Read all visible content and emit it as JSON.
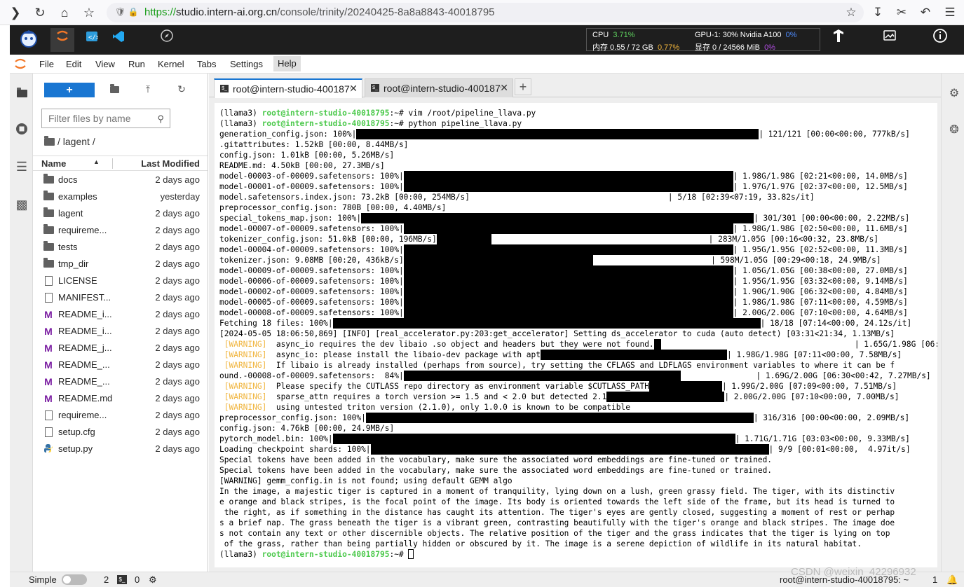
{
  "browser": {
    "url_scheme": "https://",
    "url_host": "studio.intern-ai.org.cn",
    "url_path": "/console/trinity/20240425-8a8a8843-40018795"
  },
  "monitor": {
    "cpu_label": "CPU",
    "cpu_value": "3.71%",
    "mem_label": "内存 0.55 / 72 GB",
    "mem_value": "0.77%",
    "gpu_label": "GPU-1: 30% Nvidia A100",
    "gpu_value": "0%",
    "vram_label": "显存 0 / 24566 MiB",
    "vram_value": "0%"
  },
  "menu": [
    "File",
    "Edit",
    "View",
    "Run",
    "Kernel",
    "Tabs",
    "Settings",
    "Help"
  ],
  "filebrowser": {
    "filter_placeholder": "Filter files by name",
    "breadcrumb": "/ lagent /",
    "col_name": "Name",
    "col_modified": "Last Modified",
    "files": [
      {
        "name": "docs",
        "modified": "2 days ago",
        "type": "folder"
      },
      {
        "name": "examples",
        "modified": "yesterday",
        "type": "folder"
      },
      {
        "name": "lagent",
        "modified": "2 days ago",
        "type": "folder"
      },
      {
        "name": "requireme...",
        "modified": "2 days ago",
        "type": "folder"
      },
      {
        "name": "tests",
        "modified": "2 days ago",
        "type": "folder"
      },
      {
        "name": "tmp_dir",
        "modified": "2 days ago",
        "type": "folder"
      },
      {
        "name": "LICENSE",
        "modified": "2 days ago",
        "type": "file"
      },
      {
        "name": "MANIFEST...",
        "modified": "2 days ago",
        "type": "file"
      },
      {
        "name": "README_i...",
        "modified": "2 days ago",
        "type": "markdown"
      },
      {
        "name": "README_i...",
        "modified": "2 days ago",
        "type": "markdown"
      },
      {
        "name": "README_j...",
        "modified": "2 days ago",
        "type": "markdown"
      },
      {
        "name": "README_...",
        "modified": "2 days ago",
        "type": "markdown"
      },
      {
        "name": "README_...",
        "modified": "2 days ago",
        "type": "markdown"
      },
      {
        "name": "README.md",
        "modified": "2 days ago",
        "type": "markdown"
      },
      {
        "name": "requireme...",
        "modified": "2 days ago",
        "type": "file"
      },
      {
        "name": "setup.cfg",
        "modified": "2 days ago",
        "type": "file"
      },
      {
        "name": "setup.py",
        "modified": "2 days ago",
        "type": "python"
      }
    ]
  },
  "tabs": [
    {
      "label": "root@intern-studio-40018795: ~"
    },
    {
      "label": "root@intern-studio-40018795: ~"
    }
  ],
  "terminal": {
    "prompt_env": "(llama3) ",
    "prompt_user": "root@intern-studio-40018795",
    "prompt_tail": ":~# ",
    "cmd1": "vim /root/pipeline_llava.py",
    "cmd2": "python pipeline_llava.py",
    "lines": [
      {
        "pre": "generation_config.json: 100%|",
        "bar": 574,
        "post": "| 121/121 [00:00<00:00, 777kB/s]"
      },
      {
        "pre": ".gitattributes: 1.52kB [00:00, 8.44MB/s]",
        "bar": 0,
        "post": ""
      },
      {
        "pre": "config.json: 1.01kB [00:00, 5.26MB/s]",
        "bar": 0,
        "post": ""
      },
      {
        "pre": "README.md: 4.50kB [00:00, 27.3MB/s]",
        "bar": 0,
        "post": ""
      },
      {
        "pre": "model-00003-of-00009.safetensors: 100%|",
        "bar": 470,
        "post": "| 1.98G/1.98G [02:21<00:00, 14.0MB/s]"
      },
      {
        "pre": "model-00001-of-00009.safetensors: 100%|",
        "bar": 470,
        "post": "| 1.97G/1.97G [02:37<00:00, 12.5MB/s]"
      },
      {
        "pre": "model.safetensors.index.json: 73.2kB [00:00, 254MB/s]",
        "bar": 0,
        "post": "                                          | 5/18 [02:39<07:19, 33.82s/it]"
      },
      {
        "pre": "preprocessor_config.json: 780B [00:00, 4.40MB/s]",
        "bar": 0,
        "post": ""
      },
      {
        "pre": "special_tokens_map.json: 100%|",
        "bar": 560,
        "post": "| 301/301 [00:00<00:00, 2.22MB/s]"
      },
      {
        "pre": "model-00007-of-00009.safetensors: 100%|",
        "bar": 470,
        "post": "| 1.98G/1.98G [02:50<00:00, 11.6MB/s]"
      },
      {
        "pre": "tokenizer_config.json: 51.0kB [00:00, 196MB/s]",
        "bar": 78,
        "post": "                                              | 283M/1.05G [00:16<00:32, 23.8MB/s]"
      },
      {
        "pre": "model-00004-of-00009.safetensors: 100%|",
        "bar": 470,
        "post": "| 1.95G/1.95G [02:52<00:00, 11.3MB/s]"
      },
      {
        "pre": "tokenizer.json: 9.08MB [00:20, 436kB/s]",
        "bar": 270,
        "post": "                         | 598M/1.05G [00:29<00:18, 24.9MB/s]"
      },
      {
        "pre": "model-00009-of-00009.safetensors: 100%|",
        "bar": 470,
        "post": "| 1.05G/1.05G [00:38<00:00, 27.0MB/s]"
      },
      {
        "pre": "model-00006-of-00009.safetensors: 100%|",
        "bar": 470,
        "post": "| 1.95G/1.95G [03:32<00:00, 9.14MB/s]"
      },
      {
        "pre": "model-00002-of-00009.safetensors: 100%|",
        "bar": 470,
        "post": "| 1.90G/1.90G [06:32<00:00, 4.84MB/s]"
      },
      {
        "pre": "model-00005-of-00009.safetensors: 100%|",
        "bar": 470,
        "post": "| 1.98G/1.98G [07:11<00:00, 4.59MB/s]"
      },
      {
        "pre": "model-00008-of-00009.safetensors: 100%|",
        "bar": 470,
        "post": "| 2.00G/2.00G [07:10<00:00, 4.64MB/s]"
      },
      {
        "pre": "Fetching 18 files: 100%|",
        "bar": 610,
        "post": "| 18/18 [07:14<00:00, 24.12s/it]"
      },
      {
        "pre": "[2024-05-05 18:06:50,869] [INFO] [real_accelerator.py:203:get_accelerator] Setting ds_accelerator to cuda (auto detect) [03:31<21:34, 1.13MB/s]",
        "bar": 0,
        "post": ""
      },
      {
        "warn": " [WARNING] ",
        "pre": " async_io requires the dev libaio .so object and headers but they were not found.",
        "bar": 10,
        "post": "                                         | 1.65G/1.98G [06:31<00:43, 7.59MB/s]"
      },
      {
        "warn": " [WARNING] ",
        "pre": " async_io: please install the libaio-dev package with apt",
        "bar": 266,
        "post": "| 1.98G/1.98G [07:11<00:00, 7.58MB/s]"
      },
      {
        "warn": " [WARNING] ",
        "pre": " If libaio is already installed (perhaps from source), try setting the CFLAGS and LDFLAGS environment variables to where it can be f",
        "bar": 0,
        "post": ""
      },
      {
        "pre": "ound.-00008-of-00009.safetensors:  84%|",
        "bar": 395,
        "post": "                | 1.69G/2.00G [06:30<00:42, 7.27MB/s]"
      },
      {
        "warn": " [WARNING] ",
        "pre": " Please specify the CUTLASS repo directory as environment variable $CUTLASS_PATH",
        "bar": 104,
        "post": "| 1.99G/2.00G [07:09<00:00, 7.51MB/s]"
      },
      {
        "warn": " [WARNING] ",
        "pre": " sparse_attn requires a torch version >= 1.5 and < 2.0 but detected 2.1",
        "bar": 168,
        "post": "| 2.00G/2.00G [07:10<00:00, 7.00MB/s]"
      },
      {
        "warn": " [WARNING] ",
        "pre": " using untested triton version (2.1.0), only 1.0.0 is known to be compatible",
        "bar": 0,
        "post": ""
      },
      {
        "pre": "preprocessor_config.json: 100%|",
        "bar": 553,
        "post": "| 316/316 [00:00<00:00, 2.09MB/s]"
      },
      {
        "pre": "config.json: 4.76kB [00:00, 24.9MB/s]",
        "bar": 0,
        "post": ""
      },
      {
        "pre": "pytorch_model.bin: 100%|",
        "bar": 574,
        "post": "| 1.71G/1.71G [03:03<00:00, 9.33MB/s]"
      },
      {
        "pre": "Loading checkpoint shards: 100%|",
        "bar": 568,
        "post": "| 9/9 [00:01<00:00,  4.97it/s]"
      },
      {
        "pre": "Special tokens have been added in the vocabulary, make sure the associated word embeddings are fine-tuned or trained.",
        "bar": 0,
        "post": ""
      },
      {
        "pre": "Special tokens have been added in the vocabulary, make sure the associated word embeddings are fine-tuned or trained.",
        "bar": 0,
        "post": ""
      },
      {
        "pre": "[WARNING] gemm_config.in is not found; using default GEMM algo",
        "bar": 0,
        "post": ""
      },
      {
        "pre": "In the image, a majestic tiger is captured in a moment of tranquility, lying down on a lush, green grassy field. The tiger, with its distinctiv",
        "bar": 0,
        "post": ""
      },
      {
        "pre": "e orange and black stripes, is the focal point of the image. Its body is oriented towards the left side of the frame, but its head is turned to",
        "bar": 0,
        "post": ""
      },
      {
        "pre": " the right, as if something in the distance has caught its attention. The tiger's eyes are gently closed, suggesting a moment of rest or perhap",
        "bar": 0,
        "post": ""
      },
      {
        "pre": "s a brief nap. The grass beneath the tiger is a vibrant green, contrasting beautifully with the tiger's orange and black stripes. The image doe",
        "bar": 0,
        "post": ""
      },
      {
        "pre": "s not contain any text or other discernible objects. The relative position of the tiger and the grass indicates that the tiger is lying on top",
        "bar": 0,
        "post": ""
      },
      {
        "pre": " of the grass, rather than being partially hidden or obscured by it. The image is a serene depiction of wildlife in its natural habitat.",
        "bar": 0,
        "post": ""
      }
    ]
  },
  "status": {
    "mode": "Simple",
    "count1": "2",
    "count2": "0",
    "right": "root@intern-studio-40018795: ~",
    "right_num": "1"
  },
  "watermark": "CSDN @weixin_42296932"
}
